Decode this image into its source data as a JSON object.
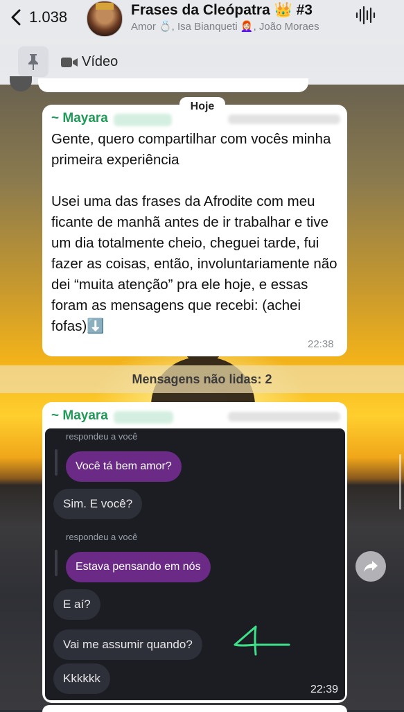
{
  "header": {
    "back_count": "1.038",
    "title": "Frases da Cleópatra 👑 #3",
    "subtitle": "Amor 💍, Isa Bianqueti 👩🏻‍🦰, João Moraes"
  },
  "pinned": {
    "label": "Vídeo"
  },
  "date_chip": "Hoje",
  "message1": {
    "sender": "~ Mayara",
    "text": "Gente, quero compartilhar com vocês minha primeira experiência\n\nUsei uma das frases da Afrodite com meu ficante de manhã antes de ir trabalhar e tive um dia totalmente cheio, cheguei tarde, fui fazer as coisas, então, involuntariamente não dei “muita atenção” pra ele hoje, e essas foram as mensagens que recebi: (achei fofas)⬇️",
    "time": "22:38"
  },
  "unread_banner": "Mensagens não lidas: 2",
  "message2": {
    "sender": "~ Mayara",
    "time": "22:39",
    "screenshot": {
      "reply_hint_1": "respondeu a você",
      "sent_1": "Você tá bem amor?",
      "recv_1": "Sim. E você?",
      "reply_hint_2": "respondeu a você",
      "sent_2": "Estava pensando em nós",
      "recv_2": "E aí?",
      "recv_3": "Vai me assumir  quando?",
      "recv_4": "Kkkkkk"
    }
  },
  "colors": {
    "sender_name": "#1f9a57",
    "sent_pill": "#6a2a86",
    "recv_pill": "#2e3039",
    "arrow_annotation": "#3ee08a"
  },
  "icons": [
    "chevron-left-icon",
    "audio-wave-icon",
    "pin-icon",
    "video-camera-icon",
    "forward-arrow-icon"
  ]
}
